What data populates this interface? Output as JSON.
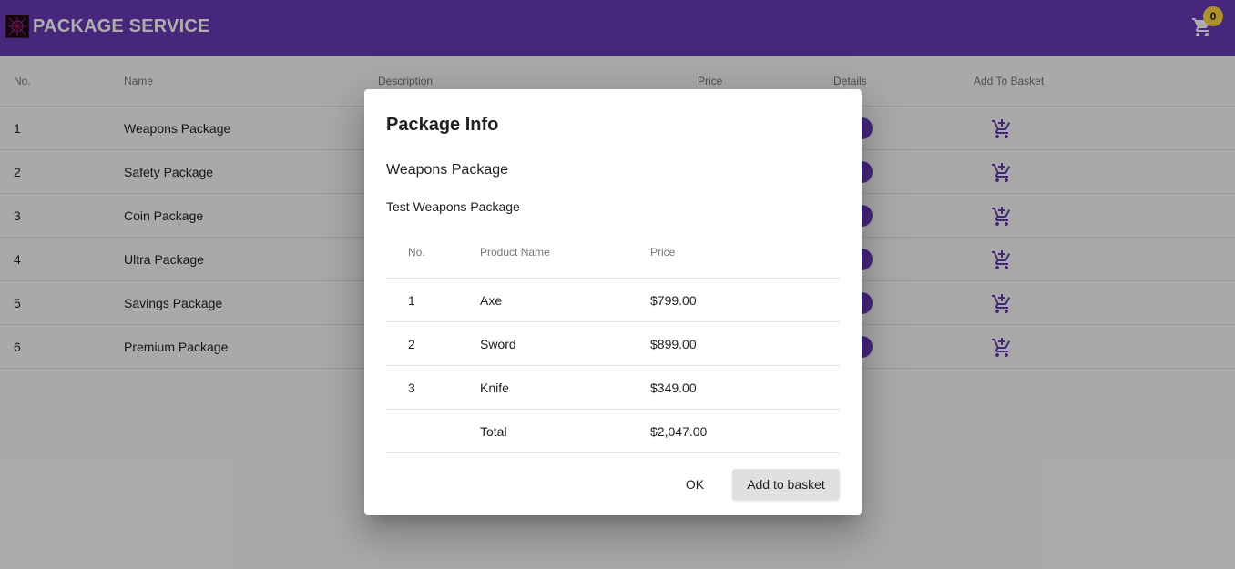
{
  "header": {
    "title": "PACKAGE SERVICE",
    "cart_count": "0",
    "brand_color": "#673ab7"
  },
  "table": {
    "columns": [
      "No.",
      "Name",
      "Description",
      "Price",
      "Details",
      "Add To Basket"
    ],
    "rows": [
      {
        "no": "1",
        "name": "Weapons Package"
      },
      {
        "no": "2",
        "name": "Safety Package"
      },
      {
        "no": "3",
        "name": "Coin Package"
      },
      {
        "no": "4",
        "name": "Ultra Package"
      },
      {
        "no": "5",
        "name": "Savings Package"
      },
      {
        "no": "6",
        "name": "Premium Package"
      }
    ]
  },
  "dialog": {
    "title": "Package Info",
    "package_name": "Weapons Package",
    "description": "Test Weapons Package",
    "columns": [
      "No.",
      "Product Name",
      "Price"
    ],
    "items": [
      {
        "no": "1",
        "name": "Axe",
        "price": "$799.00"
      },
      {
        "no": "2",
        "name": "Sword",
        "price": "$899.00"
      },
      {
        "no": "3",
        "name": "Knife",
        "price": "$349.00"
      }
    ],
    "total_label": "Total",
    "total_price": "$2,047.00",
    "ok_label": "OK",
    "add_label": "Add to basket"
  },
  "icons": {
    "cart": "shopping-cart-icon",
    "add_cart": "add-shopping-cart-icon",
    "info": "info-icon"
  }
}
